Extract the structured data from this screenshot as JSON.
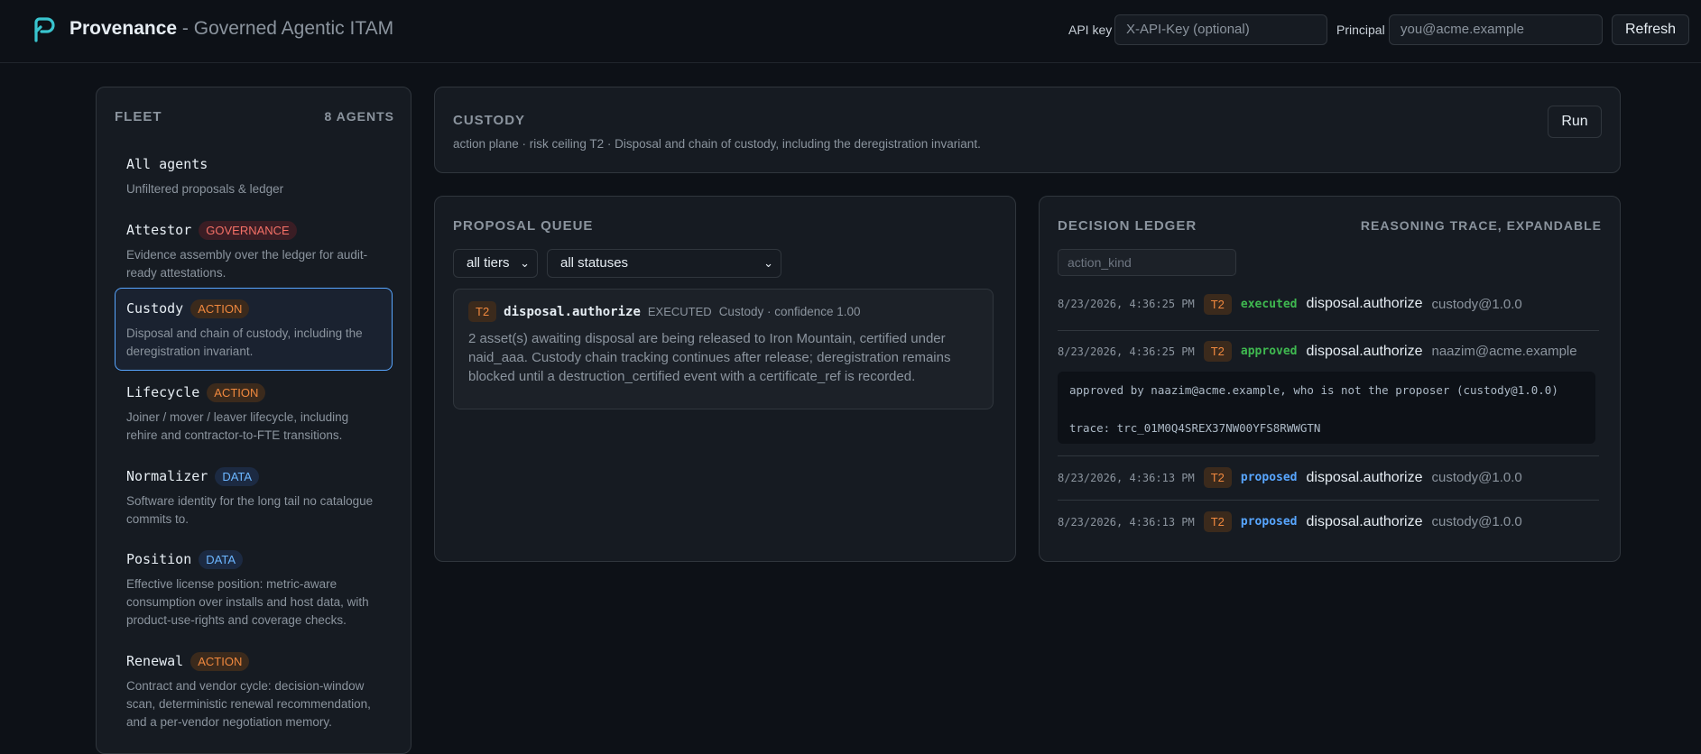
{
  "header": {
    "brand": "Provenance",
    "subtitle": "- Governed Agentic ITAM",
    "api_key_label": "API key",
    "api_key_placeholder": "X-API-Key (optional)",
    "principal_label": "Principal",
    "principal_placeholder": "you@acme.example",
    "refresh_label": "Refresh"
  },
  "fleet": {
    "title": "FLEET",
    "count": "8 AGENTS",
    "agents": [
      {
        "name": "All agents",
        "badge": "",
        "desc": "Unfiltered proposals & ledger"
      },
      {
        "name": "Attestor",
        "badge": "GOVERNANCE",
        "desc": "Evidence assembly over the ledger for audit-ready attestations."
      },
      {
        "name": "Custody",
        "badge": "ACTION",
        "desc": "Disposal and chain of custody, including the deregistration invariant."
      },
      {
        "name": "Lifecycle",
        "badge": "ACTION",
        "desc": "Joiner / mover / leaver lifecycle, including rehire and contractor-to-FTE transitions."
      },
      {
        "name": "Normalizer",
        "badge": "DATA",
        "desc": "Software identity for the long tail no catalogue commits to."
      },
      {
        "name": "Position",
        "badge": "DATA",
        "desc": "Effective license position: metric-aware consumption over installs and host data, with product-use-rights and coverage checks."
      },
      {
        "name": "Renewal",
        "badge": "ACTION",
        "desc": "Contract and vendor cycle: decision-window scan, deterministic renewal recommendation, and a per-vendor negotiation memory."
      }
    ]
  },
  "custody": {
    "title": "CUSTODY",
    "subtitle": "action plane · risk ceiling T2 · Disposal and chain of custody, including the deregistration invariant.",
    "run_label": "Run"
  },
  "queue": {
    "title": "PROPOSAL QUEUE",
    "tier_filter": "all tiers",
    "status_filter": "all statuses",
    "proposal": {
      "tier": "T2",
      "action": "disposal.authorize",
      "status": "EXECUTED",
      "meta": "Custody · confidence 1.00",
      "body": "2 asset(s) awaiting disposal are being released to Iron Mountain, certified under naid_aaa. Custody chain tracking continues after release; deregistration remains blocked until a destruction_certified event with a certificate_ref is recorded."
    }
  },
  "ledger": {
    "title": "DECISION LEDGER",
    "right_label": "REASONING TRACE, EXPANDABLE",
    "filter_placeholder": "action_kind",
    "rows": [
      {
        "ts": "8/23/2026, 4:36:25 PM",
        "tier": "T2",
        "status": "executed",
        "action": "disposal.authorize",
        "actor": "custody@1.0.0"
      },
      {
        "ts": "8/23/2026, 4:36:25 PM",
        "tier": "T2",
        "status": "approved",
        "action": "disposal.authorize",
        "actor": "naazim@acme.example"
      },
      {
        "ts": "8/23/2026, 4:36:13 PM",
        "tier": "T2",
        "status": "proposed",
        "action": "disposal.authorize",
        "actor": "custody@1.0.0"
      },
      {
        "ts": "8/23/2026, 4:36:13 PM",
        "tier": "T2",
        "status": "proposed",
        "action": "disposal.authorize",
        "actor": "custody@1.0.0"
      }
    ],
    "trace": {
      "line1": "approved by naazim@acme.example, who is not the proposer (custody@1.0.0)",
      "line2": "trace: trc_01M0Q4SREX37NW00YFS8RWWGTN"
    }
  },
  "colors": {
    "background": "#0d1117",
    "panel": "#161b22",
    "accent_blue": "#58a6ff",
    "status_green": "#3fb950",
    "tier_orange": "#f0883e",
    "governance_red": "#f47067"
  }
}
